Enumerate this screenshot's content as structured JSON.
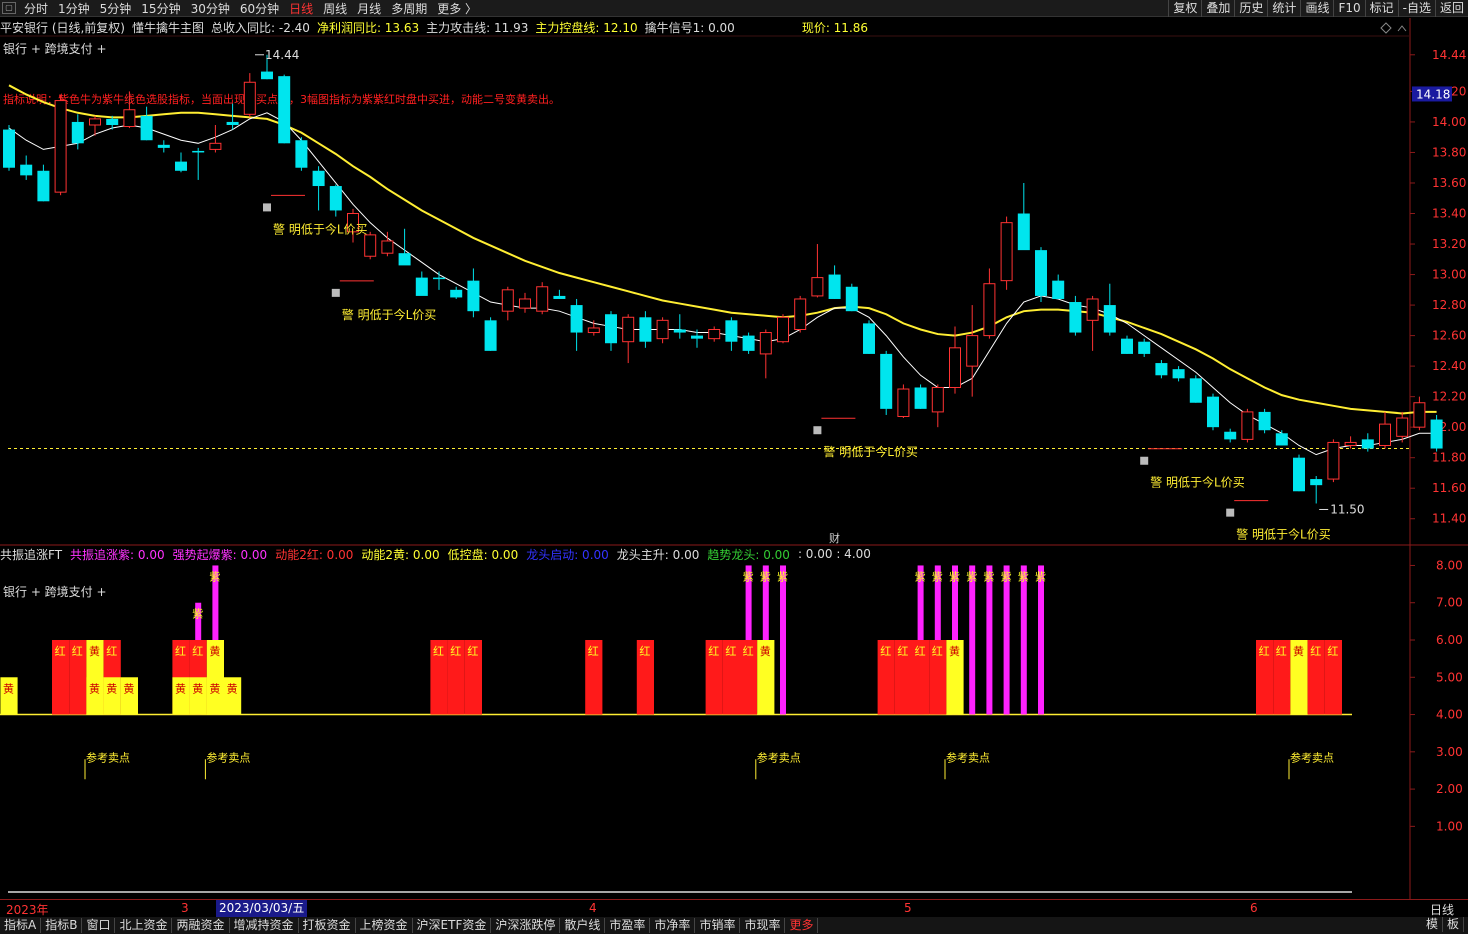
{
  "periods": [
    "分时",
    "1分钟",
    "5分钟",
    "15分钟",
    "30分钟",
    "60分钟",
    "日线",
    "周线",
    "月线",
    "多周期",
    "更多 〉"
  ],
  "active_period": "日线",
  "top_right": [
    "复权",
    "叠加",
    "历史",
    "统计",
    "画线",
    "F10",
    "标记",
    "-自选",
    "返回"
  ],
  "main_info": [
    {
      "text": "平安银行 (日线,前复权)",
      "color": "#dddddd"
    },
    {
      "text": "懂牛擒牛主图",
      "color": "#dddddd"
    },
    {
      "text": "总收入同比: -2.40",
      "color": "#dddddd"
    },
    {
      "text": "净利润同比: 13.63",
      "color": "#ffff33"
    },
    {
      "text": "主力攻击线: 11.93",
      "color": "#dddddd"
    },
    {
      "text": "主力控盘线: 12.10",
      "color": "#ffff33"
    },
    {
      "text": "擒牛信号1: 0.00",
      "color": "#dddddd"
    },
    {
      "text": "现价: 11.86",
      "color": "#ffff33"
    }
  ],
  "sub_label": "银行 + 跨境支付 +",
  "notice": "指标说明：紫色牛为紫牛线色选股指标，当面出现双买点时，3幅图指标为紫紫红时盘中买进，动能二号变黄卖出。",
  "lower_info": [
    {
      "text": "共振追涨FT",
      "color": "#dddddd"
    },
    {
      "text": "共振追涨紫: 0.00",
      "color": "#ff33ff"
    },
    {
      "text": "强势起爆紫: 0.00",
      "color": "#ff33ff"
    },
    {
      "text": "动能2红: 0.00",
      "color": "#ff3333"
    },
    {
      "text": "动能2黄: 0.00",
      "color": "#ffff33"
    },
    {
      "text": "低控盘: 0.00",
      "color": "#ffff33"
    },
    {
      "text": "龙头启动: 0.00",
      "color": "#3333ff"
    },
    {
      "text": "龙头主升: 0.00",
      "color": "#dddddd"
    },
    {
      "text": "趋势龙头: 0.00",
      "color": "#33cc33"
    },
    {
      "text": ": 0.00 : 4.00",
      "color": "#dddddd"
    }
  ],
  "price_axis": [
    "14.44",
    "14.20",
    "14.00",
    "13.80",
    "13.60",
    "13.40",
    "13.20",
    "13.00",
    "12.80",
    "12.60",
    "12.40",
    "12.20",
    "12.00",
    "11.80",
    "11.60",
    "11.40"
  ],
  "current_price_tag": "14.18",
  "lower_axis": [
    "8.00",
    "7.00",
    "6.00",
    "5.00",
    "4.00",
    "3.00",
    "2.00",
    "1.00"
  ],
  "high_label": "14.44",
  "low_label": "11.50",
  "signal_text": "警 明低于今L价买",
  "sell_text": "参考卖点",
  "cai_label": "财",
  "x_labels": {
    "year": "2023年",
    "m3": "3",
    "m4": "4",
    "m5": "5",
    "m6": "6",
    "selected": "2023/03/03/五",
    "right": "日线"
  },
  "bottom_tabs": [
    "指标A",
    "指标B",
    "窗口",
    "北上资金",
    "两融资金",
    "增减持资金",
    "打板资金",
    "上榜资金",
    "沪深ETF资金",
    "沪深涨跌停",
    "散户线",
    "市盈率",
    "市净率",
    "市销率",
    "市现率",
    "更多"
  ],
  "bottom_right": [
    "模",
    "板"
  ],
  "chart_data": {
    "type": "candlestick",
    "ylim": [
      11.3,
      14.55
    ],
    "up_color": "#ff3333",
    "down_color": "#00e5ee",
    "ma_short_color": "#ffffff",
    "ma_long_color": "#ffee33",
    "candles": [
      {
        "o": 13.95,
        "h": 13.98,
        "l": 13.68,
        "c": 13.7
      },
      {
        "o": 13.72,
        "h": 13.78,
        "l": 13.62,
        "c": 13.65
      },
      {
        "o": 13.68,
        "h": 13.72,
        "l": 13.48,
        "c": 13.48
      },
      {
        "o": 13.54,
        "h": 14.18,
        "l": 13.52,
        "c": 14.14
      },
      {
        "o": 14.0,
        "h": 14.05,
        "l": 13.82,
        "c": 13.86
      },
      {
        "o": 13.98,
        "h": 14.04,
        "l": 13.91,
        "c": 14.02
      },
      {
        "o": 14.02,
        "h": 14.04,
        "l": 13.95,
        "c": 13.98
      },
      {
        "o": 13.97,
        "h": 14.2,
        "l": 13.96,
        "c": 14.08
      },
      {
        "o": 14.04,
        "h": 14.1,
        "l": 13.88,
        "c": 13.88
      },
      {
        "o": 13.85,
        "h": 13.88,
        "l": 13.8,
        "c": 13.83
      },
      {
        "o": 13.74,
        "h": 13.8,
        "l": 13.67,
        "c": 13.68
      },
      {
        "o": 13.81,
        "h": 13.83,
        "l": 13.62,
        "c": 13.8
      },
      {
        "o": 13.82,
        "h": 13.98,
        "l": 13.8,
        "c": 13.86
      },
      {
        "o": 14.0,
        "h": 14.12,
        "l": 13.95,
        "c": 13.98
      },
      {
        "o": 14.05,
        "h": 14.32,
        "l": 14.03,
        "c": 14.26
      },
      {
        "o": 14.33,
        "h": 14.44,
        "l": 14.28,
        "c": 14.28
      },
      {
        "o": 14.3,
        "h": 14.31,
        "l": 13.86,
        "c": 13.86
      },
      {
        "o": 13.88,
        "h": 13.9,
        "l": 13.68,
        "c": 13.7
      },
      {
        "o": 13.68,
        "h": 13.71,
        "l": 13.42,
        "c": 13.58
      },
      {
        "o": 13.58,
        "h": 13.59,
        "l": 13.38,
        "c": 13.42
      },
      {
        "o": 13.28,
        "h": 13.43,
        "l": 13.21,
        "c": 13.4
      },
      {
        "o": 13.12,
        "h": 13.28,
        "l": 13.1,
        "c": 13.26
      },
      {
        "o": 13.14,
        "h": 13.28,
        "l": 13.12,
        "c": 13.22
      },
      {
        "o": 13.14,
        "h": 13.3,
        "l": 13.1,
        "c": 13.06
      },
      {
        "o": 12.98,
        "h": 13.02,
        "l": 12.9,
        "c": 12.86
      },
      {
        "o": 12.98,
        "h": 13.02,
        "l": 12.9,
        "c": 12.97
      },
      {
        "o": 12.9,
        "h": 12.92,
        "l": 12.84,
        "c": 12.85
      },
      {
        "o": 12.96,
        "h": 13.04,
        "l": 12.72,
        "c": 12.76
      },
      {
        "o": 12.7,
        "h": 12.72,
        "l": 12.5,
        "c": 12.5
      },
      {
        "o": 12.76,
        "h": 12.92,
        "l": 12.7,
        "c": 12.9
      },
      {
        "o": 12.78,
        "h": 12.88,
        "l": 12.75,
        "c": 12.84
      },
      {
        "o": 12.76,
        "h": 12.95,
        "l": 12.74,
        "c": 12.92
      },
      {
        "o": 12.86,
        "h": 12.9,
        "l": 12.84,
        "c": 12.84
      },
      {
        "o": 12.8,
        "h": 12.84,
        "l": 12.5,
        "c": 12.62
      },
      {
        "o": 12.62,
        "h": 12.7,
        "l": 12.6,
        "c": 12.65
      },
      {
        "o": 12.74,
        "h": 12.76,
        "l": 12.5,
        "c": 12.55
      },
      {
        "o": 12.56,
        "h": 12.74,
        "l": 12.42,
        "c": 12.72
      },
      {
        "o": 12.72,
        "h": 12.76,
        "l": 12.52,
        "c": 12.56
      },
      {
        "o": 12.58,
        "h": 12.72,
        "l": 12.55,
        "c": 12.7
      },
      {
        "o": 12.64,
        "h": 12.74,
        "l": 12.58,
        "c": 12.62
      },
      {
        "o": 12.6,
        "h": 12.64,
        "l": 12.52,
        "c": 12.58
      },
      {
        "o": 12.58,
        "h": 12.66,
        "l": 12.56,
        "c": 12.64
      },
      {
        "o": 12.7,
        "h": 12.72,
        "l": 12.5,
        "c": 12.56
      },
      {
        "o": 12.6,
        "h": 12.62,
        "l": 12.48,
        "c": 12.5
      },
      {
        "o": 12.48,
        "h": 12.64,
        "l": 12.32,
        "c": 12.62
      },
      {
        "o": 12.56,
        "h": 12.74,
        "l": 12.55,
        "c": 12.72
      },
      {
        "o": 12.64,
        "h": 12.86,
        "l": 12.62,
        "c": 12.84
      },
      {
        "o": 12.86,
        "h": 13.2,
        "l": 12.85,
        "c": 12.98
      },
      {
        "o": 13.0,
        "h": 13.06,
        "l": 12.84,
        "c": 12.84
      },
      {
        "o": 12.92,
        "h": 12.94,
        "l": 12.76,
        "c": 12.76
      },
      {
        "o": 12.68,
        "h": 12.7,
        "l": 12.48,
        "c": 12.48
      },
      {
        "o": 12.48,
        "h": 12.5,
        "l": 12.08,
        "c": 12.12
      },
      {
        "o": 12.07,
        "h": 12.28,
        "l": 12.06,
        "c": 12.25
      },
      {
        "o": 12.26,
        "h": 12.28,
        "l": 12.12,
        "c": 12.12
      },
      {
        "o": 12.1,
        "h": 12.28,
        "l": 12.0,
        "c": 12.26
      },
      {
        "o": 12.26,
        "h": 12.66,
        "l": 12.22,
        "c": 12.52
      },
      {
        "o": 12.4,
        "h": 12.8,
        "l": 12.2,
        "c": 12.6
      },
      {
        "o": 12.6,
        "h": 13.04,
        "l": 12.58,
        "c": 12.94
      },
      {
        "o": 12.96,
        "h": 13.38,
        "l": 12.9,
        "c": 13.34
      },
      {
        "o": 13.4,
        "h": 13.6,
        "l": 13.2,
        "c": 13.16
      },
      {
        "o": 13.16,
        "h": 13.18,
        "l": 12.82,
        "c": 12.86
      },
      {
        "o": 12.96,
        "h": 13.0,
        "l": 12.84,
        "c": 12.84
      },
      {
        "o": 12.82,
        "h": 12.86,
        "l": 12.6,
        "c": 12.62
      },
      {
        "o": 12.7,
        "h": 12.86,
        "l": 12.5,
        "c": 12.84
      },
      {
        "o": 12.8,
        "h": 12.94,
        "l": 12.6,
        "c": 12.62
      },
      {
        "o": 12.58,
        "h": 12.6,
        "l": 12.48,
        "c": 12.48
      },
      {
        "o": 12.56,
        "h": 12.58,
        "l": 12.46,
        "c": 12.48
      },
      {
        "o": 12.42,
        "h": 12.44,
        "l": 12.32,
        "c": 12.34
      },
      {
        "o": 12.38,
        "h": 12.4,
        "l": 12.3,
        "c": 12.32
      },
      {
        "o": 12.32,
        "h": 12.34,
        "l": 12.16,
        "c": 12.16
      },
      {
        "o": 12.2,
        "h": 12.22,
        "l": 11.98,
        "c": 12.0
      },
      {
        "o": 11.97,
        "h": 11.99,
        "l": 11.9,
        "c": 11.92
      },
      {
        "o": 11.92,
        "h": 12.12,
        "l": 11.9,
        "c": 12.1
      },
      {
        "o": 12.1,
        "h": 12.12,
        "l": 11.96,
        "c": 11.98
      },
      {
        "o": 11.96,
        "h": 11.98,
        "l": 11.88,
        "c": 11.88
      },
      {
        "o": 11.8,
        "h": 11.82,
        "l": 11.58,
        "c": 11.58
      },
      {
        "o": 11.66,
        "h": 11.68,
        "l": 11.5,
        "c": 11.62
      },
      {
        "o": 11.66,
        "h": 11.92,
        "l": 11.64,
        "c": 11.9
      },
      {
        "o": 11.88,
        "h": 11.94,
        "l": 11.86,
        "c": 11.9
      },
      {
        "o": 11.92,
        "h": 11.96,
        "l": 11.84,
        "c": 11.86
      },
      {
        "o": 11.88,
        "h": 12.1,
        "l": 11.86,
        "c": 12.02
      },
      {
        "o": 11.94,
        "h": 12.1,
        "l": 11.9,
        "c": 12.06
      },
      {
        "o": 12.0,
        "h": 12.2,
        "l": 11.98,
        "c": 12.16
      },
      {
        "o": 12.05,
        "h": 12.08,
        "l": 11.84,
        "c": 11.86
      }
    ],
    "ma_short": [
      13.96,
      13.88,
      13.82,
      13.84,
      13.86,
      13.92,
      13.96,
      13.98,
      13.96,
      13.92,
      13.88,
      13.86,
      13.9,
      13.95,
      14.02,
      14.06,
      14.0,
      13.88,
      13.74,
      13.6,
      13.46,
      13.34,
      13.24,
      13.16,
      13.08,
      13.0,
      12.94,
      12.88,
      12.82,
      12.8,
      12.78,
      12.78,
      12.76,
      12.72,
      12.68,
      12.66,
      12.64,
      12.64,
      12.64,
      12.64,
      12.62,
      12.62,
      12.6,
      12.58,
      12.56,
      12.58,
      12.64,
      12.72,
      12.78,
      12.78,
      12.72,
      12.6,
      12.46,
      12.34,
      12.26,
      12.26,
      12.32,
      12.5,
      12.68,
      12.82,
      12.86,
      12.84,
      12.8,
      12.78,
      12.74,
      12.68,
      12.6,
      12.52,
      12.44,
      12.36,
      12.26,
      12.16,
      12.08,
      12.02,
      11.96,
      11.88,
      11.82,
      11.86,
      11.88,
      11.88,
      11.9,
      11.92,
      11.96,
      11.96
    ],
    "ma_long": [
      14.24,
      14.18,
      14.13,
      14.09,
      14.06,
      14.04,
      14.03,
      14.03,
      14.04,
      14.05,
      14.06,
      14.06,
      14.05,
      14.04,
      14.03,
      14.02,
      13.98,
      13.93,
      13.86,
      13.79,
      13.71,
      13.64,
      13.56,
      13.49,
      13.42,
      13.36,
      13.3,
      13.24,
      13.19,
      13.14,
      13.09,
      13.05,
      13.01,
      12.98,
      12.95,
      12.92,
      12.89,
      12.86,
      12.83,
      12.81,
      12.79,
      12.77,
      12.75,
      12.74,
      12.73,
      12.72,
      12.73,
      12.75,
      12.78,
      12.79,
      12.78,
      12.74,
      12.68,
      12.64,
      12.61,
      12.6,
      12.62,
      12.66,
      12.72,
      12.76,
      12.77,
      12.77,
      12.76,
      12.75,
      12.72,
      12.69,
      12.65,
      12.61,
      12.56,
      12.51,
      12.45,
      12.38,
      12.32,
      12.26,
      12.21,
      12.18,
      12.16,
      12.14,
      12.12,
      12.11,
      12.1,
      12.09,
      12.1,
      12.1
    ],
    "dashed_price": 11.86
  },
  "indicator_bars": [
    {
      "i": 0,
      "top": 5.0,
      "color": "yellow",
      "label": "黄"
    },
    {
      "i": 3,
      "top": 6.0,
      "color": "red",
      "label": "红"
    },
    {
      "i": 4,
      "top": 6.0,
      "color": "red",
      "label": "红"
    },
    {
      "i": 5,
      "top": 6.0,
      "color": "yellow",
      "label": "黄"
    },
    {
      "i": 5,
      "top": 5.0,
      "color": "yellow",
      "label": "黄"
    },
    {
      "i": 6,
      "top": 6.0,
      "color": "red",
      "label": "红"
    },
    {
      "i": 6,
      "top": 5.0,
      "color": "yellow",
      "label": "黄"
    },
    {
      "i": 7,
      "top": 5.0,
      "color": "yellow",
      "label": "黄"
    },
    {
      "i": 10,
      "top": 6.0,
      "color": "red",
      "label": "红"
    },
    {
      "i": 10,
      "top": 5.0,
      "color": "yellow",
      "label": "黄"
    },
    {
      "i": 11,
      "top": 7.0,
      "color": "magenta",
      "label": "紫"
    },
    {
      "i": 11,
      "top": 6.0,
      "color": "red",
      "label": "红"
    },
    {
      "i": 11,
      "top": 5.0,
      "color": "yellow",
      "label": "黄"
    },
    {
      "i": 12,
      "top": 8.0,
      "color": "magenta",
      "label": "紫"
    },
    {
      "i": 12,
      "top": 6.0,
      "color": "yellow",
      "label": "黄"
    },
    {
      "i": 12,
      "top": 5.0,
      "color": "yellow",
      "label": "黄"
    },
    {
      "i": 13,
      "top": 5.0,
      "color": "yellow",
      "label": "黄"
    },
    {
      "i": 25,
      "top": 6.0,
      "color": "red",
      "label": "红"
    },
    {
      "i": 26,
      "top": 6.0,
      "color": "red",
      "label": "红"
    },
    {
      "i": 27,
      "top": 6.0,
      "color": "red",
      "label": "红"
    },
    {
      "i": 34,
      "top": 6.0,
      "color": "red",
      "label": "红"
    },
    {
      "i": 37,
      "top": 6.0,
      "color": "red",
      "label": "红"
    },
    {
      "i": 41,
      "top": 6.0,
      "color": "red",
      "label": "红"
    },
    {
      "i": 42,
      "top": 6.0,
      "color": "red",
      "label": "红"
    },
    {
      "i": 43,
      "top": 8.0,
      "color": "magenta",
      "label": "紫"
    },
    {
      "i": 43,
      "top": 6.0,
      "color": "red",
      "label": "红"
    },
    {
      "i": 44,
      "top": 8.0,
      "color": "magenta",
      "label": "紫"
    },
    {
      "i": 44,
      "top": 6.0,
      "color": "yellow",
      "label": "黄"
    },
    {
      "i": 45,
      "top": 8.0,
      "color": "magenta",
      "label": "紫"
    },
    {
      "i": 51,
      "top": 6.0,
      "color": "red",
      "label": "红"
    },
    {
      "i": 52,
      "top": 6.0,
      "color": "red",
      "label": "红"
    },
    {
      "i": 53,
      "top": 8.0,
      "color": "magenta",
      "label": "紫"
    },
    {
      "i": 53,
      "top": 6.0,
      "color": "red",
      "label": "红"
    },
    {
      "i": 54,
      "top": 8.0,
      "color": "magenta",
      "label": "紫"
    },
    {
      "i": 54,
      "top": 6.0,
      "color": "red",
      "label": "红"
    },
    {
      "i": 55,
      "top": 8.0,
      "color": "magenta",
      "label": "紫"
    },
    {
      "i": 55,
      "top": 6.0,
      "color": "yellow",
      "label": "黄"
    },
    {
      "i": 56,
      "top": 8.0,
      "color": "magenta",
      "label": "紫"
    },
    {
      "i": 57,
      "top": 8.0,
      "color": "magenta",
      "label": "紫"
    },
    {
      "i": 58,
      "top": 8.0,
      "color": "magenta",
      "label": "紫"
    },
    {
      "i": 59,
      "top": 8.0,
      "color": "magenta",
      "label": "紫"
    },
    {
      "i": 60,
      "top": 8.0,
      "color": "magenta",
      "label": "紫"
    },
    {
      "i": 73,
      "top": 6.0,
      "color": "red",
      "label": "红"
    },
    {
      "i": 74,
      "top": 6.0,
      "color": "red",
      "label": "红"
    },
    {
      "i": 75,
      "top": 6.0,
      "color": "yellow",
      "label": "黄"
    },
    {
      "i": 76,
      "top": 6.0,
      "color": "red",
      "label": "红"
    },
    {
      "i": 77,
      "top": 6.0,
      "color": "red",
      "label": "红"
    }
  ],
  "signals": [
    {
      "i": 15,
      "price": 13.44
    },
    {
      "i": 19,
      "price": 12.88
    },
    {
      "i": 47,
      "price": 11.98
    },
    {
      "i": 66,
      "price": 11.78
    },
    {
      "i": 71,
      "price": 11.44
    }
  ],
  "sell_points": [
    5,
    12,
    44,
    55,
    75
  ]
}
